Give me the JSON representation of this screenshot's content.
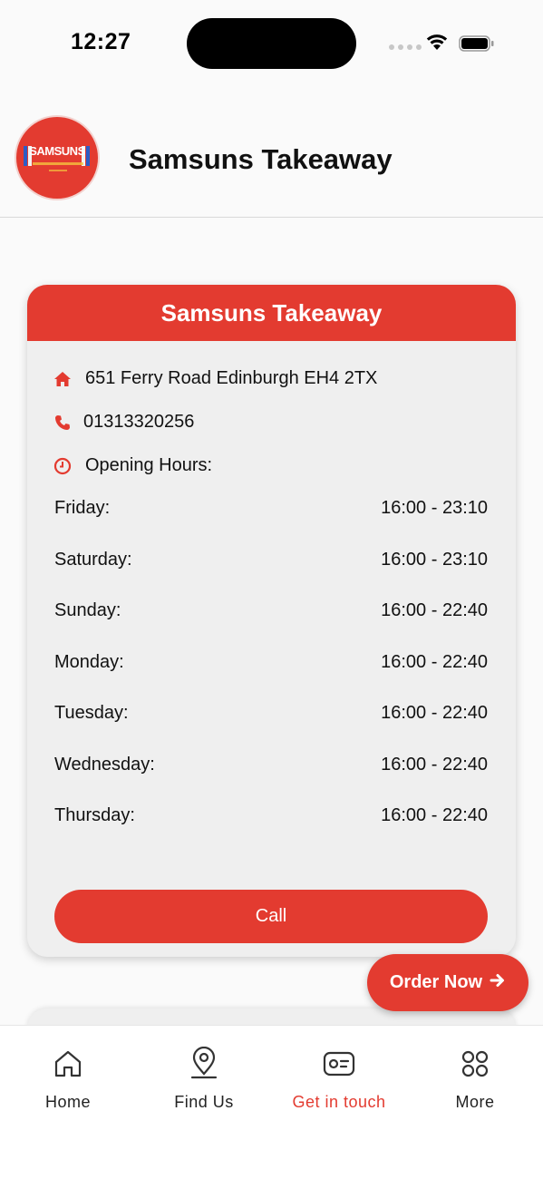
{
  "status_bar": {
    "time": "12:27"
  },
  "header": {
    "logo_text": "SAMSUNS",
    "title": "Samsuns Takeaway"
  },
  "card": {
    "title": "Samsuns Takeaway",
    "address": "651 Ferry Road Edinburgh EH4 2TX",
    "phone": "01313320256",
    "opening_hours_label": "Opening Hours:",
    "hours": [
      {
        "day": "Friday:",
        "time": "16:00 - 23:10"
      },
      {
        "day": "Saturday:",
        "time": "16:00 - 23:10"
      },
      {
        "day": "Sunday:",
        "time": "16:00 - 22:40"
      },
      {
        "day": "Monday:",
        "time": "16:00 - 22:40"
      },
      {
        "day": "Tuesday:",
        "time": "16:00 - 22:40"
      },
      {
        "day": "Wednesday:",
        "time": "16:00 - 22:40"
      },
      {
        "day": "Thursday:",
        "time": "16:00 - 22:40"
      }
    ],
    "call_label": "Call"
  },
  "order_now": {
    "label": "Order Now"
  },
  "tabs": [
    {
      "label": "Home",
      "icon": "home-icon"
    },
    {
      "label": "Find Us",
      "icon": "location-pin-icon"
    },
    {
      "label": "Get in touch",
      "icon": "contact-card-icon",
      "active": true
    },
    {
      "label": "More",
      "icon": "grid-icon"
    }
  ],
  "colors": {
    "brand": "#e33b30",
    "background": "#fafafa",
    "card": "#efefef"
  }
}
